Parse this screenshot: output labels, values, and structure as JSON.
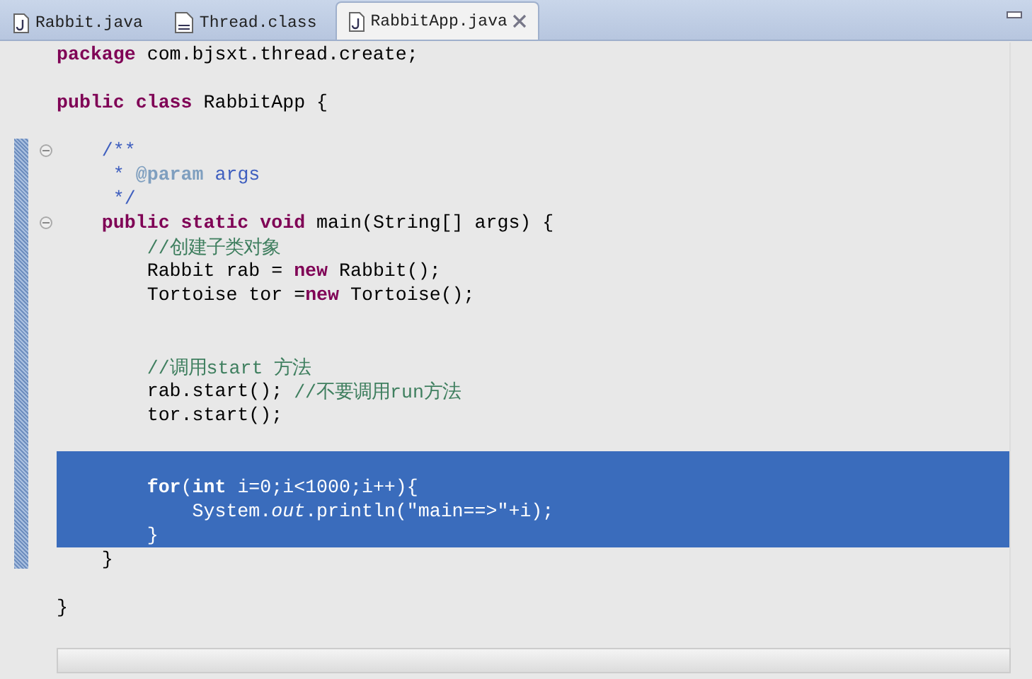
{
  "tabs": [
    {
      "label": "Rabbit.java",
      "kind": "java",
      "selected": false
    },
    {
      "label": "Thread.class",
      "kind": "class",
      "selected": false
    },
    {
      "label": "RabbitApp.java",
      "kind": "java",
      "selected": true
    }
  ],
  "editor": {
    "lines": [
      {
        "selected": false,
        "segments": [
          {
            "t": "package",
            "kind": "keyword"
          },
          {
            "t": " com.bjsxt.thread.create;",
            "kind": "plain"
          }
        ]
      },
      {
        "selected": false
      },
      {
        "selected": false,
        "segments": [
          {
            "t": "public class",
            "kind": "keyword"
          },
          {
            "t": " RabbitApp {",
            "kind": "plain"
          }
        ]
      },
      {
        "selected": false
      },
      {
        "selected": false,
        "fold": true,
        "segments": [
          {
            "t": "    /**",
            "kind": "javadoc"
          }
        ]
      },
      {
        "selected": false,
        "segments": [
          {
            "t": "     * ",
            "kind": "javadoc"
          },
          {
            "t": "@param",
            "kind": "tag"
          },
          {
            "t": " args",
            "kind": "javadoc"
          }
        ]
      },
      {
        "selected": false,
        "segments": [
          {
            "t": "     */",
            "kind": "javadoc"
          }
        ]
      },
      {
        "selected": false,
        "fold": true,
        "segments": [
          {
            "t": "    public static void",
            "kind": "keyword"
          },
          {
            "t": " main(String[] args) {",
            "kind": "plain"
          }
        ]
      },
      {
        "selected": false,
        "segments": [
          {
            "t": "        //创建子类对象",
            "kind": "comment"
          }
        ]
      },
      {
        "selected": false,
        "segments": [
          {
            "t": "        Rabbit rab = ",
            "kind": "plain"
          },
          {
            "t": "new",
            "kind": "keyword"
          },
          {
            "t": " Rabbit();",
            "kind": "plain"
          }
        ]
      },
      {
        "selected": false,
        "segments": [
          {
            "t": "        Tortoise tor =",
            "kind": "plain"
          },
          {
            "t": "new",
            "kind": "keyword"
          },
          {
            "t": " Tortoise();",
            "kind": "plain"
          }
        ]
      },
      {
        "selected": false
      },
      {
        "selected": false
      },
      {
        "selected": false,
        "segments": [
          {
            "t": "        //调用start 方法",
            "kind": "comment"
          }
        ]
      },
      {
        "selected": false,
        "segments": [
          {
            "t": "        rab.start(); ",
            "kind": "plain"
          },
          {
            "t": "//不要调用run方法",
            "kind": "comment"
          }
        ]
      },
      {
        "selected": false,
        "segments": [
          {
            "t": "        tor.start();",
            "kind": "plain"
          }
        ]
      },
      {
        "selected": false
      },
      {
        "selected": true
      },
      {
        "selected": true,
        "segments": [
          {
            "t": "        for",
            "kind": "keyword"
          },
          {
            "t": "(",
            "kind": "plain"
          },
          {
            "t": "int",
            "kind": "keyword"
          },
          {
            "t": " i=0;i<1000;i++){",
            "kind": "plain"
          }
        ]
      },
      {
        "selected": true,
        "segments": [
          {
            "t": "            System.",
            "kind": "plain"
          },
          {
            "t": "out",
            "kind": "field"
          },
          {
            "t": ".println(",
            "kind": "plain"
          },
          {
            "t": "\"main==>\"",
            "kind": "string"
          },
          {
            "t": "+i);",
            "kind": "plain"
          }
        ]
      },
      {
        "selected": true,
        "segments": [
          {
            "t": "        }",
            "kind": "plain"
          }
        ]
      },
      {
        "selected": false,
        "segments": [
          {
            "t": "    }",
            "kind": "plain"
          }
        ]
      },
      {
        "selected": false
      },
      {
        "selected": false,
        "segments": [
          {
            "t": "}",
            "kind": "plain"
          }
        ]
      }
    ]
  }
}
